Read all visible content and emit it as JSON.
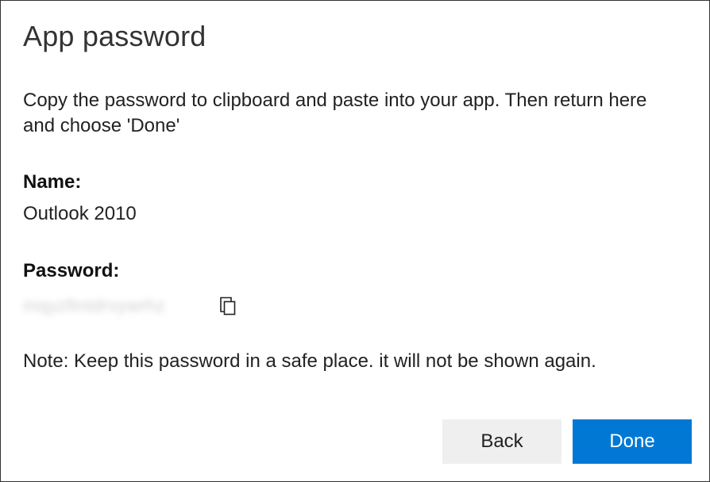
{
  "dialog": {
    "title": "App password",
    "instruction": "Copy the password to clipboard and paste into your app. Then return here and choose 'Done'",
    "nameLabel": "Name:",
    "nameValue": "Outlook 2010",
    "passwordLabel": "Password:",
    "passwordValue": "mqyzftntdrvywrhz",
    "note": "Note: Keep this password in a safe place. it will not be shown again.",
    "buttons": {
      "back": "Back",
      "done": "Done"
    },
    "icons": {
      "copy": "copy-icon"
    }
  }
}
